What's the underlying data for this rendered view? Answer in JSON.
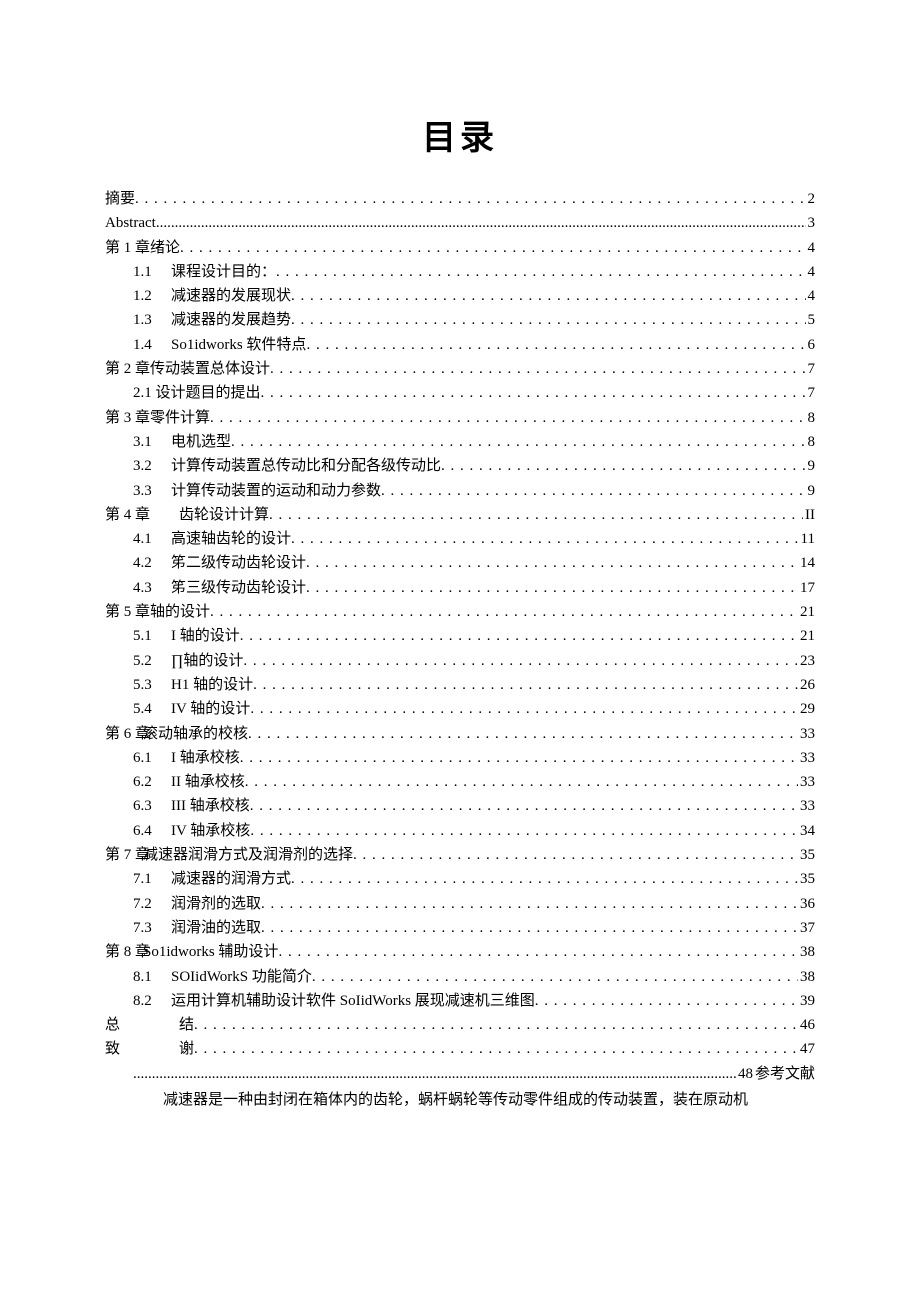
{
  "title": "目录",
  "entries": [
    {
      "level": 0,
      "num": "",
      "text": "摘要",
      "page": "2",
      "dots": "d1"
    },
    {
      "level": 0,
      "num": "",
      "text": "Abstract",
      "page": "3",
      "dots": "d2"
    },
    {
      "level": 0,
      "num": "",
      "text": "第 1 章绪论",
      "page": "4",
      "dots": "d1"
    },
    {
      "level": 1,
      "num": "1.1",
      "text": "课程设计目的：",
      "page": "4",
      "dots": "d1"
    },
    {
      "level": 1,
      "num": "1.2",
      "text": "减速器的发展现状",
      "page": "4",
      "dots": "d1"
    },
    {
      "level": 1,
      "num": "1.3",
      "text": "减速器的发展趋势",
      "page": "5",
      "dots": "d1"
    },
    {
      "level": 1,
      "num": "1.4",
      "text": "So1idworks 软件特点",
      "page": "6",
      "dots": "d1"
    },
    {
      "level": 0,
      "num": "",
      "text": "第 2 章传动装置总体设计",
      "page": "7",
      "dots": "d1"
    },
    {
      "level": 1,
      "num": "",
      "text": "2.1 设计题目的提出",
      "page": "7",
      "dots": "d1"
    },
    {
      "level": 0,
      "num": "",
      "text": "第 3 章零件计算",
      "page": "8",
      "dots": "d1"
    },
    {
      "level": 1,
      "num": "3.1",
      "text": "电机选型",
      "page": "8",
      "dots": "d1"
    },
    {
      "level": 1,
      "num": "3.2",
      "text": "计算传动装置总传动比和分配各级传动比",
      "page": "9",
      "dots": "d1"
    },
    {
      "level": 1,
      "num": "3.3",
      "text": "计算传动装置的运动和动力参数",
      "page": "9",
      "dots": "d1"
    },
    {
      "level": 0,
      "num": "第 4 章",
      "text": "齿轮设计计算",
      "page": "II",
      "dots": "d1",
      "gap": true
    },
    {
      "level": 1,
      "num": "4.1",
      "text": "高速轴齿轮的设计",
      "page": "11",
      "dots": "d1"
    },
    {
      "level": 1,
      "num": "4.2",
      "text": "笫二级传动齿轮设计",
      "page": "14",
      "dots": "d1"
    },
    {
      "level": 1,
      "num": "4.3",
      "text": "笫三级传动齿轮设计",
      "page": "17",
      "dots": "d1"
    },
    {
      "level": 0,
      "num": "",
      "text": "第 5 章轴的设计",
      "page": "21",
      "dots": "d1"
    },
    {
      "level": 1,
      "num": "5.1",
      "text": "I 轴的设计",
      "page": "21",
      "dots": "d1"
    },
    {
      "level": 1,
      "num": "5.2",
      "text": "∏轴的设计",
      "page": "23",
      "dots": "d1"
    },
    {
      "level": 1,
      "num": "5.3",
      "text": "H1 轴的设计",
      "page": "26",
      "dots": "d1"
    },
    {
      "level": 1,
      "num": "5.4",
      "text": "IV 轴的设计",
      "page": "29",
      "dots": "d1"
    },
    {
      "level": 0,
      "num": "第 6 章",
      "text": "滚动轴承的校核",
      "page": "33",
      "dots": "d1"
    },
    {
      "level": 1,
      "num": "6.1",
      "text": "I 轴承校核",
      "page": "33",
      "dots": "d1"
    },
    {
      "level": 1,
      "num": "6.2",
      "text": "II 轴承校核",
      "page": "33",
      "dots": "d1"
    },
    {
      "level": 1,
      "num": "6.3",
      "text": "III 轴承校核",
      "page": "33",
      "dots": "d1"
    },
    {
      "level": 1,
      "num": "6.4",
      "text": "IV 轴承校核",
      "page": "34",
      "dots": "d1"
    },
    {
      "level": 0,
      "num": "第 7 章",
      "text": "减速器润滑方式及润滑剂的选择",
      "page": "35",
      "dots": "d1"
    },
    {
      "level": 1,
      "num": "7.1",
      "text": "减速器的润滑方式",
      "page": "35",
      "dots": "d1"
    },
    {
      "level": 1,
      "num": "7.2",
      "text": "润滑剂的选取",
      "page": "36",
      "dots": "d1"
    },
    {
      "level": 1,
      "num": "7.3",
      "text": "润滑油的选取",
      "page": "37",
      "dots": "d1"
    },
    {
      "level": 0,
      "num": "第 8 章",
      "text": "So1idworks 辅助设计",
      "page": "38",
      "dots": "d1"
    },
    {
      "level": 1,
      "num": "8.1",
      "text": "SOIidWorkS 功能简介",
      "page": "38",
      "dots": "d1"
    },
    {
      "level": 1,
      "num": "8.2",
      "text": "运用计算机辅助设计软件 SoIidWorks 展现减速机三维图",
      "page": "39",
      "dots": "d1"
    },
    {
      "level": 0,
      "num": "总",
      "text": "结",
      "page": "46",
      "dots": "d1",
      "gap": true
    },
    {
      "level": 0,
      "num": "致",
      "text": "谢",
      "page": "47",
      "dots": "d1",
      "gap": true
    },
    {
      "level": 1,
      "num": "",
      "text": "",
      "page": "48",
      "dots": "d2",
      "trail": " 参考文献"
    }
  ],
  "paragraph": "减速器是一种由封闭在箱体内的齿轮，蜗杆蜗轮等传动零件组成的传动装置，装在原动机"
}
